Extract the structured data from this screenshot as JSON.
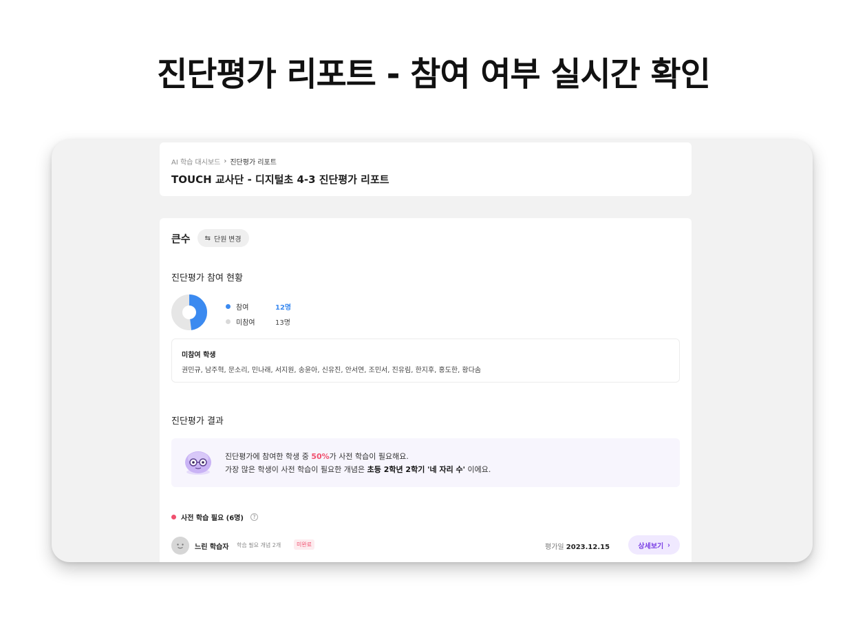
{
  "headline": "진단평가 리포트 - 참여 여부 실시간 확인",
  "breadcrumb": {
    "parent": "AI 학습 대시보드",
    "current": "진단평가 리포트"
  },
  "page_title": "TOUCH 교사단 - 디지털초 4-3 진단평가 리포트",
  "unit": {
    "name": "큰수",
    "change_label": "단원 변경",
    "change_icon": "swap-icon"
  },
  "participation": {
    "title": "진단평가 참여 현황",
    "participated_label": "참여",
    "participated_count": "12명",
    "absent_label": "미참여",
    "absent_count": "13명",
    "participated_value": 12,
    "absent_value": 13,
    "colors": {
      "participated": "#3b8af0",
      "absent": "#e6e6e6"
    }
  },
  "absent_students": {
    "title": "미참여 학생",
    "names": "권민규, 남주혁, 문소리, 민나래, 서지원, 송윤아, 신유진, 안서연, 조민서, 진유림, 한지후, 홍도한, 황다솜"
  },
  "result": {
    "title": "진단평가 결과",
    "line1_prefix": "진단평가에 참여한 학생 중 ",
    "line1_highlight": "50%",
    "line1_suffix": "가 사전 학습이 필요해요.",
    "line2_prefix": "가장 많은 학생이 사전 학습이 필요한 개념은 ",
    "line2_bold": "초등 2학년 2학기 '네 자리 수'",
    "line2_suffix": " 이에요."
  },
  "need_study": {
    "label": "사전 학습 필요 (6명)",
    "help_icon": "question-icon"
  },
  "student_row": {
    "name": "느린 학습자",
    "meta": "학습 필요 개념 2개",
    "status": "미완료",
    "date_label": "평가일",
    "date": "2023.12.15",
    "detail_label": "상세보기"
  }
}
